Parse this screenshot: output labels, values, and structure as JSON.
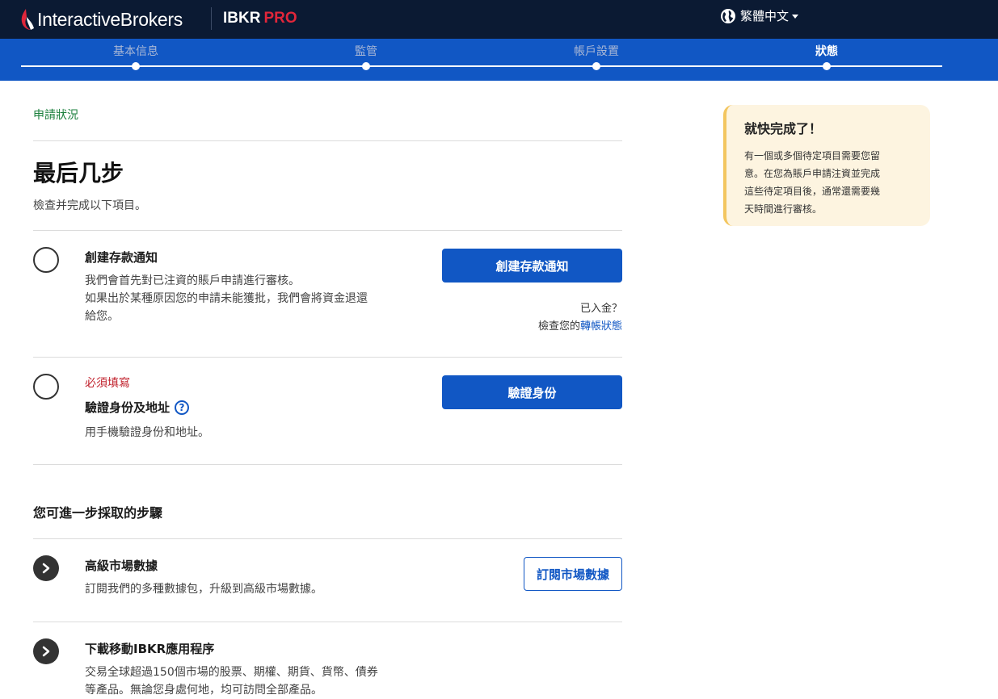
{
  "header": {
    "brand_name": "InteractiveBrokers",
    "product_name": "IBKR",
    "product_tier": "PRO",
    "language": "繁體中文",
    "colors": {
      "bar": "#0b1a33",
      "accent_red": "#e0263a"
    }
  },
  "stepper": {
    "steps": [
      {
        "label": "基本信息"
      },
      {
        "label": "監管"
      },
      {
        "label": "帳戶設置"
      },
      {
        "label": "狀態"
      }
    ],
    "active_index": 3,
    "colors": {
      "bar": "#1157c4"
    }
  },
  "main": {
    "breadcrumb": "申請狀況",
    "title": "最后几步",
    "subtitle": "檢查并完成以下項目。",
    "tasks": [
      {
        "title": "創建存款通知",
        "desc_lines": [
          "我們會首先對已注資的賬戶申請進行審核。",
          "如果出於某種原因您的申請未能獲批，我們會將資金退還",
          "給您。"
        ],
        "button": "創建存款通知",
        "deposited_question": "已入金？",
        "check_prefix": "檢查您的",
        "transfer_link": "轉帳狀態"
      },
      {
        "required": "必須填寫",
        "title": "驗證身份及地址",
        "help_icon": "?",
        "desc": "用手機驗證身份和地址。",
        "button": "驗證身份"
      }
    ],
    "further_title": "您可進一步採取的步驟",
    "further": [
      {
        "title": "高級市場數據",
        "desc": "訂閱我們的多種數據包，升級到高級市場數據。",
        "button": "訂閱市場數據"
      },
      {
        "title": "下載移動IBKR應用程序",
        "desc_lines": [
          "交易全球超過150個市場的股票、期權、期貨、貨幣、債券",
          "等產品。無論您身處何地，均可訪問全部產品。"
        ]
      }
    ]
  },
  "sidebar_note": {
    "title": "就快完成了！",
    "lines": [
      "有一個或多個待定項目需要您留",
      "意。在您為賬戶申請注資並完成",
      "這些待定項目後，通常還需要幾",
      "天時間進行審核。"
    ]
  },
  "icons": {
    "brand": "flame-logo-icon",
    "language": "globe-icon",
    "pending": "empty-circle-icon",
    "next": "chevron-right-icon"
  }
}
